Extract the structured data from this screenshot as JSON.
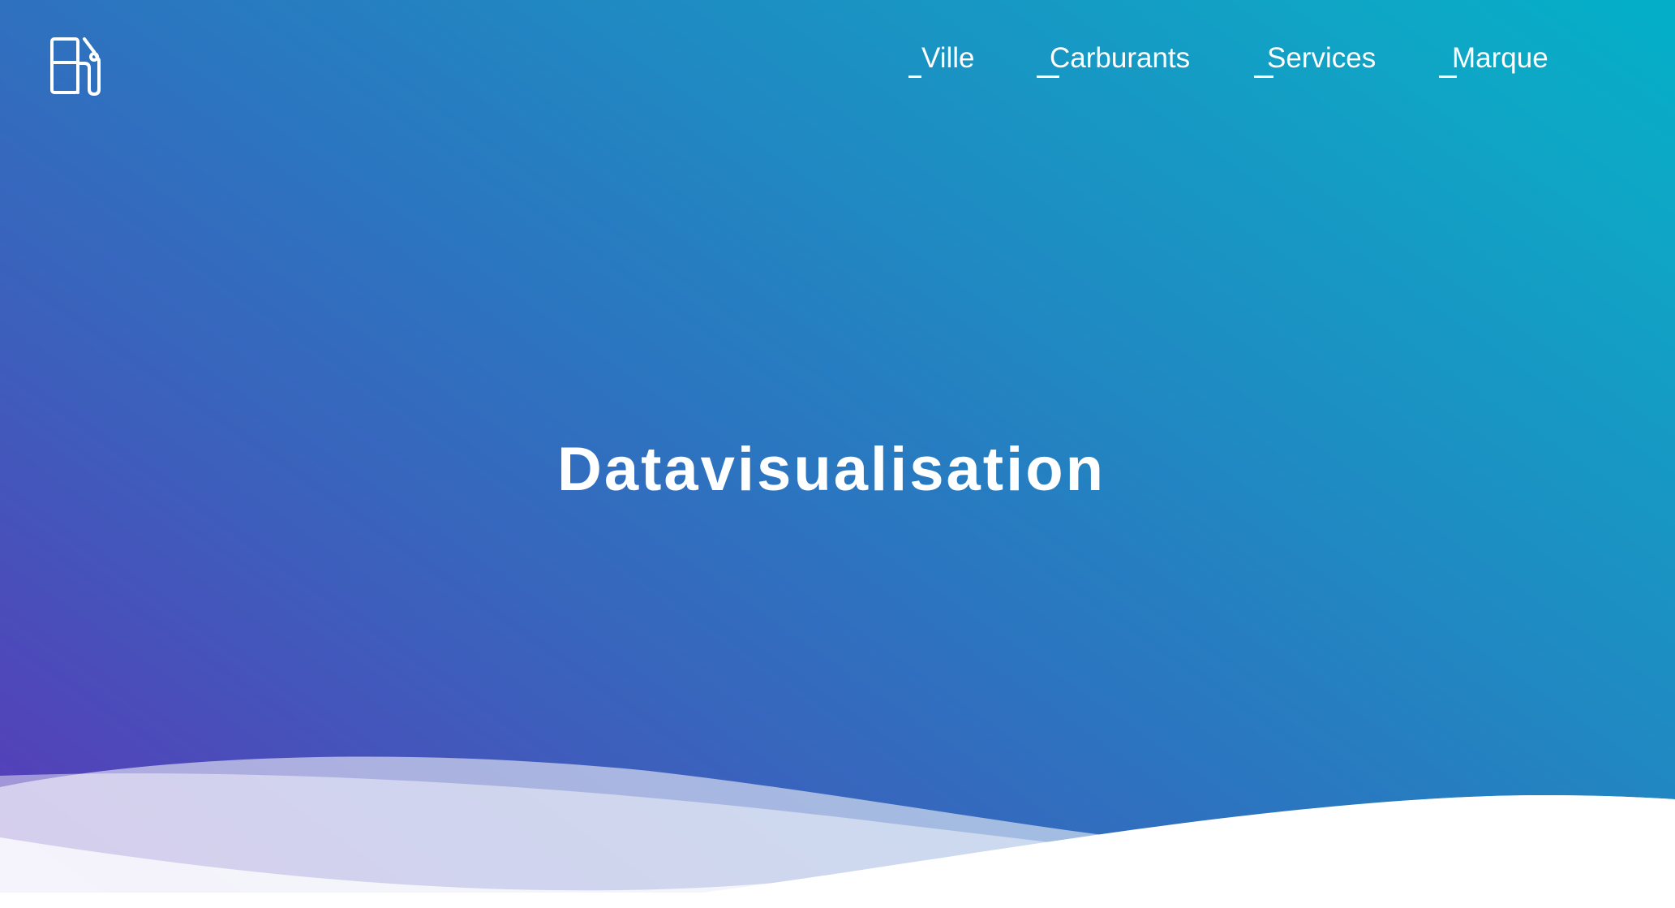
{
  "header": {
    "logo_icon": "fuel-pump-icon",
    "nav": [
      {
        "label": "Ville"
      },
      {
        "label": "Carburants"
      },
      {
        "label": "Services"
      },
      {
        "label": "Marque"
      }
    ]
  },
  "hero": {
    "title": "Datavisualisation"
  },
  "colors": {
    "gradient_start": "#5a38b8",
    "gradient_end": "#03afc8",
    "text": "#ffffff"
  }
}
